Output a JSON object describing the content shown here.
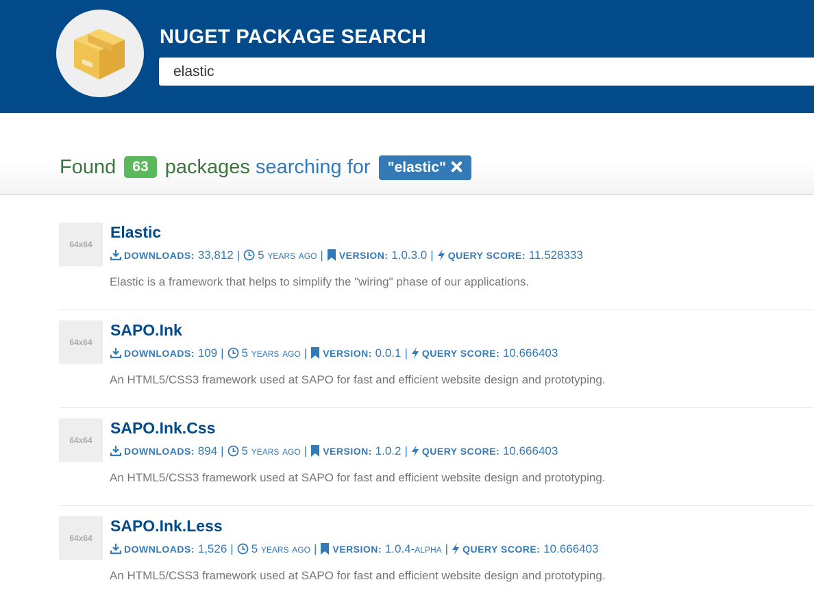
{
  "header": {
    "title": "NUGET PACKAGE SEARCH",
    "search_value": "elastic",
    "logo_icon": "package-box-icon"
  },
  "summary": {
    "found": "Found",
    "count": "63",
    "packages": "packages",
    "searching_for": "searching for",
    "query": "\"elastic\""
  },
  "labels": {
    "downloads": "DOWNLOADS:",
    "version": "VERSION:",
    "query_score": "QUERY SCORE:",
    "thumb": "64x64"
  },
  "results": [
    {
      "name": "Elastic",
      "downloads": "33,812",
      "age": "5 years ago",
      "version": "1.0.3.0",
      "score": "11.528333",
      "description": "Elastic is a framework that helps to simplify the \"wiring\" phase of our applications."
    },
    {
      "name": "SAPO.Ink",
      "downloads": "109",
      "age": "5 years ago",
      "version": "0.0.1",
      "score": "10.666403",
      "description": "An HTML5/CSS3 framework used at SAPO for fast and efficient website design and prototyping."
    },
    {
      "name": "SAPO.Ink.Css",
      "downloads": "894",
      "age": "5 years ago",
      "version": "1.0.2",
      "score": "10.666403",
      "description": "An HTML5/CSS3 framework used at SAPO for fast and efficient website design and prototyping."
    },
    {
      "name": "SAPO.Ink.Less",
      "downloads": "1,526",
      "age": "5 years ago",
      "version": "1.0.4-alpha",
      "score": "10.666403",
      "description": "An HTML5/CSS3 framework used at SAPO for fast and efficient website design and prototyping."
    }
  ],
  "colors": {
    "header_bg": "#034a8a",
    "accent_blue": "#337ab7",
    "success_green": "#5cb85c",
    "found_text_green": "#3c763d",
    "description_gray": "#777777"
  }
}
